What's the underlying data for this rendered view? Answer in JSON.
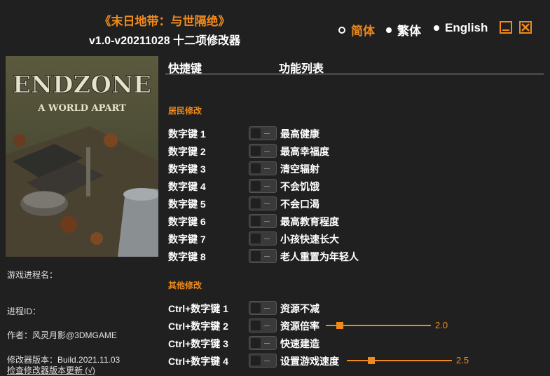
{
  "header": {
    "title": "《末日地带：与世隔绝》",
    "subtitle": "v1.0-v20211028 十二项修改器"
  },
  "languages": [
    {
      "label": "简体",
      "selected": true
    },
    {
      "label": "繁体",
      "selected": false
    },
    {
      "label": "English",
      "selected": false
    }
  ],
  "cover": {
    "title": "ENDZONE",
    "subtitle": "A WORLD APART"
  },
  "info": {
    "process_name_label": "游戏进程名：",
    "process_id_label": "进程ID：",
    "author": "作者：风灵月影@3DMGAME",
    "version": "修改器版本：Build.2021.11.03",
    "update_link": "检查修改器版本更新 (√)"
  },
  "columns": {
    "hotkey": "快捷键",
    "features": "功能列表"
  },
  "sections": [
    {
      "title": "居民修改",
      "items": [
        {
          "key": "数字键 1",
          "name": "最高健康"
        },
        {
          "key": "数字键 2",
          "name": "最高幸福度"
        },
        {
          "key": "数字键 3",
          "name": "清空辐射"
        },
        {
          "key": "数字键 4",
          "name": "不会饥饿"
        },
        {
          "key": "数字键 5",
          "name": "不会口渴"
        },
        {
          "key": "数字键 6",
          "name": "最高教育程度"
        },
        {
          "key": "数字键 7",
          "name": "小孩快速长大"
        },
        {
          "key": "数字键 8",
          "name": "老人重置为年轻人"
        }
      ]
    },
    {
      "title": "其他修改",
      "items": [
        {
          "key": "Ctrl+数字键 1",
          "name": "资源不减"
        },
        {
          "key": "Ctrl+数字键 2",
          "name": "资源倍率",
          "slider": {
            "value": "2.0",
            "fraction": 0.1
          }
        },
        {
          "key": "Ctrl+数字键 3",
          "name": "快速建造"
        },
        {
          "key": "Ctrl+数字键 4",
          "name": "设置游戏速度",
          "slider": {
            "value": "2.5",
            "fraction": 0.2
          }
        }
      ]
    }
  ],
  "colors": {
    "accent": "#f08a1c",
    "background": "#202020"
  },
  "icons": {
    "minimize": "minimize-icon",
    "close": "close-icon"
  }
}
